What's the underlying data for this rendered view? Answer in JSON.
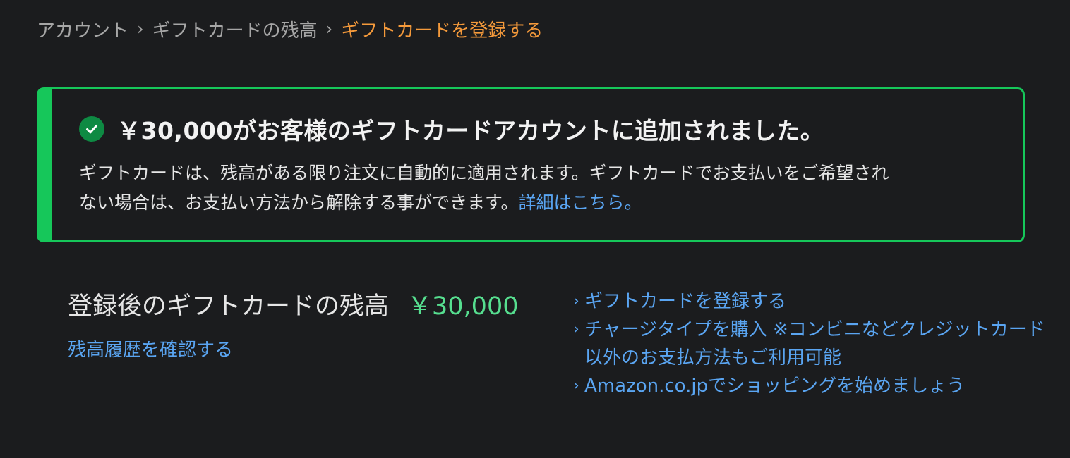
{
  "breadcrumb": {
    "items": [
      {
        "label": "アカウント"
      },
      {
        "label": "ギフトカードの残高"
      },
      {
        "label": "ギフトカードを登録する"
      }
    ],
    "separator": "›"
  },
  "alert": {
    "status_icon": "check-circle-icon",
    "title": "￥30,000がお客様のギフトカードアカウントに追加されました。",
    "body_line1": "ギフトカードは、残高がある限り注文に自動的に適用されます。ギフトカードでお支払いをご希望され",
    "body_line2": "ない場合は、お支払い方法から解除する事ができます。",
    "details_link": "詳細はこちら。"
  },
  "balance": {
    "label": "登録後のギフトカードの残高",
    "amount": "￥30,000",
    "history_link": "残高履歴を確認する"
  },
  "links": [
    {
      "label": "ギフトカードを登録する"
    },
    {
      "label": "チャージタイプを購入 ※コンビニなどクレジットカード以外のお支払方法もご利用可能"
    },
    {
      "label": "Amazon.co.jpでショッピングを始めましょう"
    }
  ],
  "colors": {
    "background": "#1b1c1e",
    "success_green": "#16c75a",
    "amount_green": "#56de8f",
    "link_blue": "#5aa5f2",
    "breadcrumb_current": "#f59a3b"
  }
}
